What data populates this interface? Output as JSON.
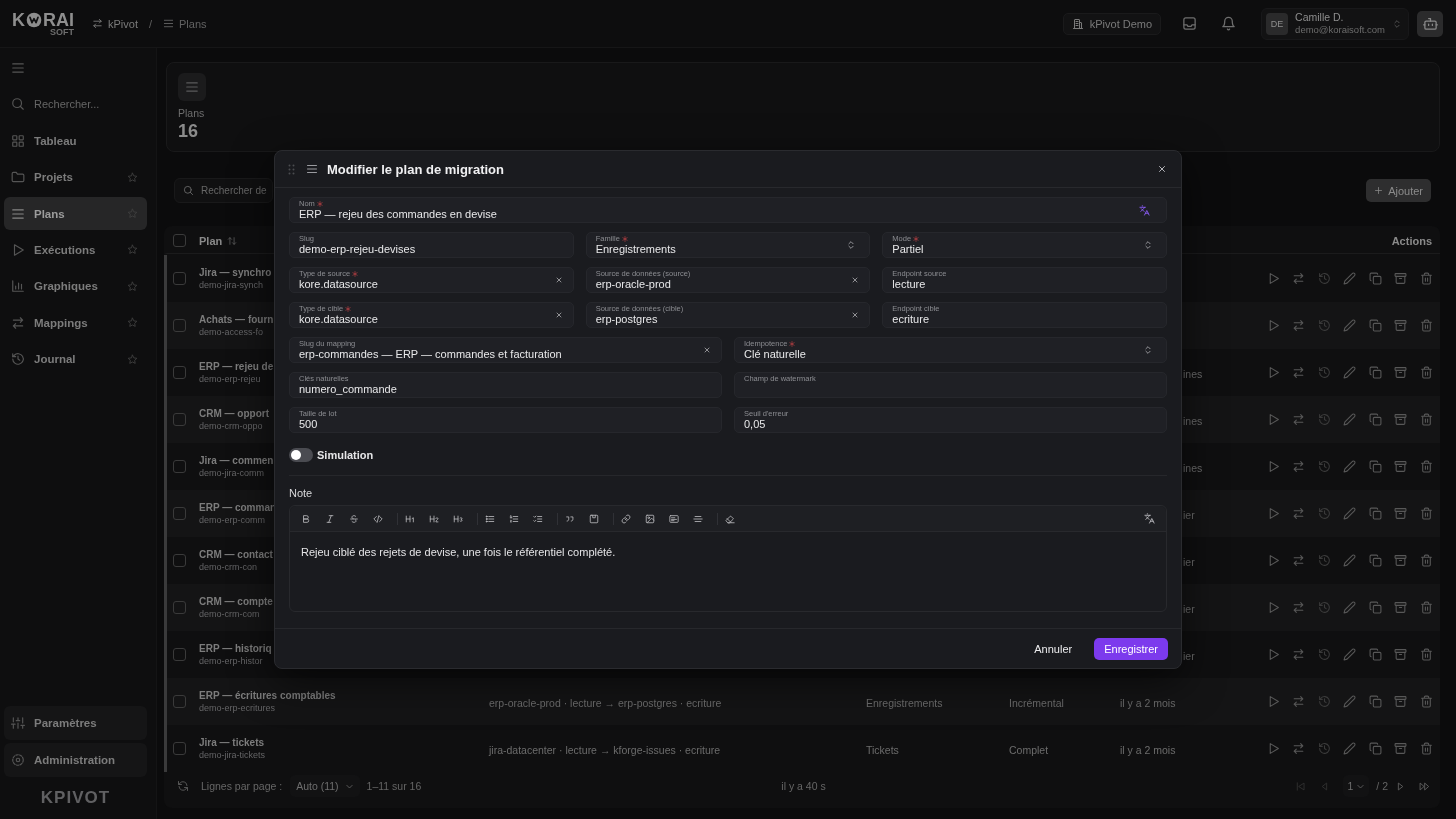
{
  "topbar": {
    "logo": {
      "start": "K",
      "end": "RAI",
      "tagline": "SOFT"
    },
    "breadcrumb": [
      {
        "label": "kPivot"
      },
      {
        "label": "Plans"
      }
    ],
    "separator": "/",
    "workspace": "kPivot Demo",
    "user": {
      "initials": "DE",
      "name": "Camille D.",
      "email": "demo@koraisoft.com"
    }
  },
  "sidebar": {
    "search_placeholder": "Rechercher...",
    "items": [
      {
        "label": "Tableau",
        "selected": false
      },
      {
        "label": "Projets",
        "selected": false,
        "favorite": false
      },
      {
        "label": "Plans",
        "selected": true,
        "favorite": false
      },
      {
        "label": "Exécutions",
        "selected": false,
        "favorite": false
      },
      {
        "label": "Graphiques",
        "selected": false,
        "favorite": false
      },
      {
        "label": "Mappings",
        "selected": false,
        "favorite": false
      },
      {
        "label": "Journal",
        "selected": false,
        "favorite": false
      }
    ],
    "footer_items": [
      {
        "label": "Paramètres"
      },
      {
        "label": "Administration"
      }
    ],
    "brand": "KPIVOT"
  },
  "summary": {
    "label": "Plans",
    "value": "16"
  },
  "toolbar": {
    "search_placeholder": "Rechercher de",
    "add_button": "Ajouter"
  },
  "table": {
    "all_selected": false,
    "columns": [
      {
        "label": "Plan",
        "sortable": true
      },
      {
        "label": "Actions"
      }
    ],
    "rows": [
      {
        "title": "Jira — synchro",
        "slug": "demo-jira-synch",
        "selected": false
      },
      {
        "title": "Achats — fourn",
        "slug": "demo-access-fo",
        "selected": false
      },
      {
        "title": "ERP — rejeu de",
        "slug": "demo-erp-rejeu",
        "selected": false,
        "last_run_end": "ines"
      },
      {
        "title": "CRM — opport",
        "slug": "demo-crm-oppo",
        "selected": false,
        "last_run_end": "ines"
      },
      {
        "title": "Jira — commen",
        "slug": "demo-jira-comm",
        "selected": false,
        "last_run_end": "ines"
      },
      {
        "title": "ERP — comman",
        "slug": "demo-erp-comm",
        "selected": false,
        "last_run_end": "ier"
      },
      {
        "title": "CRM — contact",
        "slug": "demo-crm-con",
        "selected": false,
        "last_run_end": "ier"
      },
      {
        "title": "CRM — compte",
        "slug": "demo-crm-com",
        "selected": false,
        "last_run_end": "ier"
      },
      {
        "title": "ERP — historiq",
        "slug": "demo-erp-histor",
        "selected": false,
        "last_run_end": "ier"
      },
      {
        "title": "ERP — écritures comptables",
        "slug": "demo-erp-ecritures",
        "selected": false,
        "route": "erp-oracle-prod · lecture → erp-postgres · ecriture",
        "family": "Enregistrements",
        "mode": "Incrémental",
        "last_run": "il y a 2 mois"
      },
      {
        "title": "Jira — tickets",
        "slug": "demo-jira-tickets",
        "selected": false,
        "route": "jira-datacenter · lecture → kforge-issues · ecriture",
        "family": "Tickets",
        "mode": "Complet",
        "last_run": "il y a 2 mois"
      }
    ]
  },
  "pagination": {
    "label": "Lignes par page :",
    "page_size": "Auto (11)",
    "range": "1–11 sur 16",
    "refreshed": "il y a 40 s",
    "page": "1",
    "page_count": "/ 2",
    "nav": [
      {
        "disabled": true
      },
      {
        "disabled": true
      },
      {
        "disabled": false
      },
      {
        "disabled": false
      }
    ]
  },
  "dialog": {
    "title": "Modifier le plan de migration",
    "field_rows": [
      [
        {
          "label": "Nom",
          "required": true,
          "kind": "translatable",
          "value": "ERP — rejeu des commandes en devise"
        }
      ],
      [
        {
          "label": "Slug",
          "required": false,
          "kind": "text",
          "value": "demo-erp-rejeu-devises"
        },
        {
          "label": "Famille",
          "required": true,
          "kind": "select",
          "value": "Enregistrements"
        },
        {
          "label": "Mode",
          "required": true,
          "kind": "select",
          "value": "Partiel"
        }
      ],
      [
        {
          "label": "Type de source",
          "required": true,
          "kind": "clearable",
          "value": "kore.datasource"
        },
        {
          "label": "Source de données (source)",
          "required": false,
          "kind": "clearable",
          "value": "erp-oracle-prod"
        },
        {
          "label": "Endpoint source",
          "required": false,
          "kind": "text",
          "value": "lecture"
        }
      ],
      [
        {
          "label": "Type de cible",
          "required": true,
          "kind": "clearable",
          "value": "kore.datasource"
        },
        {
          "label": "Source de données (cible)",
          "required": false,
          "kind": "clearable",
          "value": "erp-postgres"
        },
        {
          "label": "Endpoint cible",
          "required": false,
          "kind": "text",
          "value": "ecriture"
        }
      ],
      [
        {
          "label": "Slug du mapping",
          "required": false,
          "kind": "clearable",
          "value": "erp-commandes — ERP — commandes et facturation"
        },
        {
          "label": "Idempotence",
          "required": true,
          "kind": "select",
          "value": "Clé naturelle"
        }
      ],
      [
        {
          "label": "Clés naturelles",
          "required": false,
          "kind": "text",
          "value": "numero_commande"
        },
        {
          "label": "Champ de watermark",
          "required": false,
          "kind": "text"
        }
      ],
      [
        {
          "label": "Taille de lot",
          "required": false,
          "kind": "text",
          "value": "500"
        },
        {
          "label": "Seuil d'erreur",
          "required": false,
          "kind": "text",
          "value": "0,05"
        }
      ]
    ],
    "simulation": {
      "label": "Simulation",
      "on": false
    },
    "note": {
      "label": "Note",
      "text": "Rejeu ciblé des rejets de devise, une fois le référentiel complété."
    },
    "buttons": [
      {
        "label": "Annuler",
        "kind": "secondary"
      },
      {
        "label": "Enregistrer",
        "kind": "primary"
      }
    ]
  }
}
